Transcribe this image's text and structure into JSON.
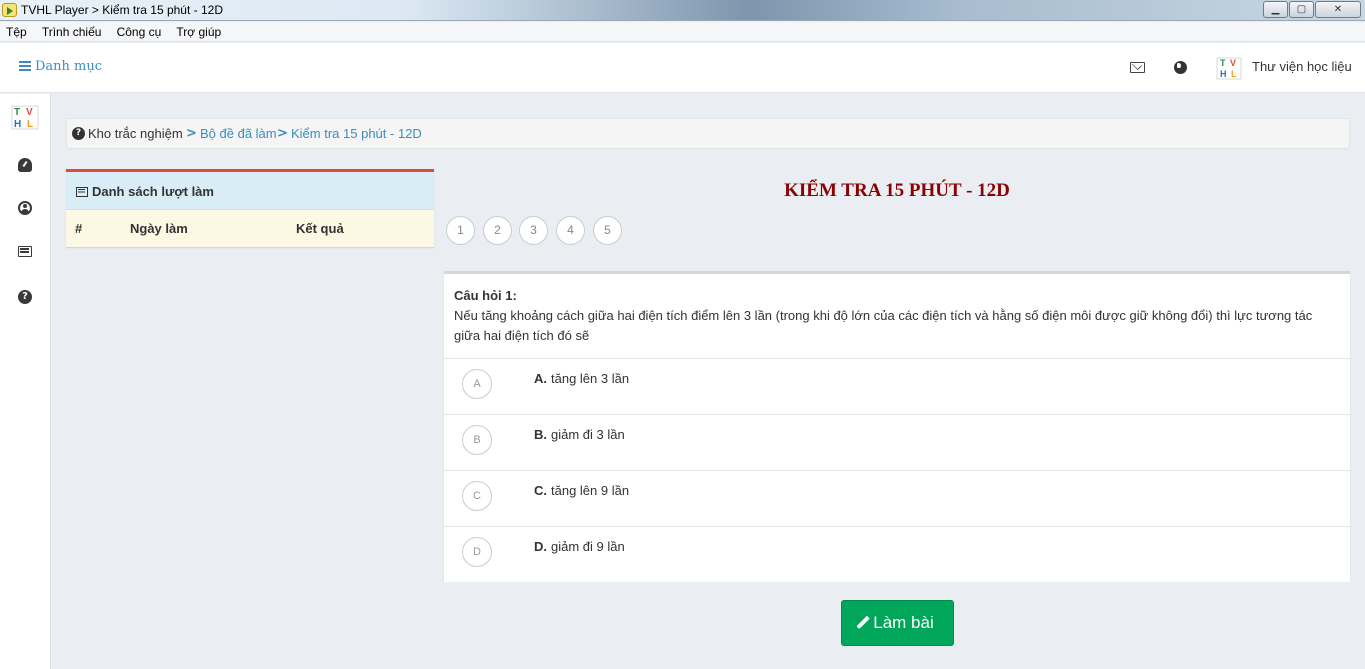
{
  "window": {
    "title": "TVHL Player > Kiểm tra 15 phút - 12D",
    "minimize_glyph": "▁",
    "maximize_glyph": "▢",
    "close_glyph": "✕"
  },
  "menu": [
    "Tệp",
    "Trình chiếu",
    "Công cụ",
    "Trợ giúp"
  ],
  "header": {
    "menu_label": "Danh mục",
    "brand_name": "Thư viện học liệu",
    "icons": [
      "envelope-icon",
      "globe-icon"
    ]
  },
  "rail": {
    "icons": [
      "dashboard-icon",
      "user-icon",
      "list-icon",
      "help-icon"
    ],
    "help_glyph": "?"
  },
  "breadcrumb": {
    "icon_glyph": "?",
    "items": [
      "Kho trắc nghiệm",
      "Bộ đề đã làm",
      "Kiểm tra 15 phút - 12D"
    ],
    "separator": ">"
  },
  "history": {
    "title": "Danh sách lượt làm",
    "columns": [
      "#",
      "Ngày làm",
      "Kết quả"
    ],
    "rows": []
  },
  "quiz": {
    "title": "KIỂM TRA 15 PHÚT - 12D",
    "pages": [
      "1",
      "2",
      "3",
      "4",
      "5"
    ],
    "question_label": "Câu hỏi 1:",
    "question_text": "Nếu tăng khoảng cách giữa hai điện tích điểm lên 3 lần (trong khi độ lớn của các điện tích và hằng số điện môi được giữ không đổi) thì lực tương tác giữa hai điện tích đó sẽ",
    "options": [
      {
        "letter": "A",
        "label": "A.",
        "text": "tăng lên 3 lần"
      },
      {
        "letter": "B",
        "label": "B.",
        "text": "giảm đi 3 lần"
      },
      {
        "letter": "C",
        "label": "C.",
        "text": "tăng lên 9 lần"
      },
      {
        "letter": "D",
        "label": "D.",
        "text": "giảm đi 9 lần"
      }
    ]
  },
  "submit_label": "Làm bài",
  "colors": {
    "accent_blue": "#3c8dbc",
    "title_red": "#8b0000",
    "submit_green": "#00a65a",
    "panel_top_red": "#dd4b39"
  }
}
